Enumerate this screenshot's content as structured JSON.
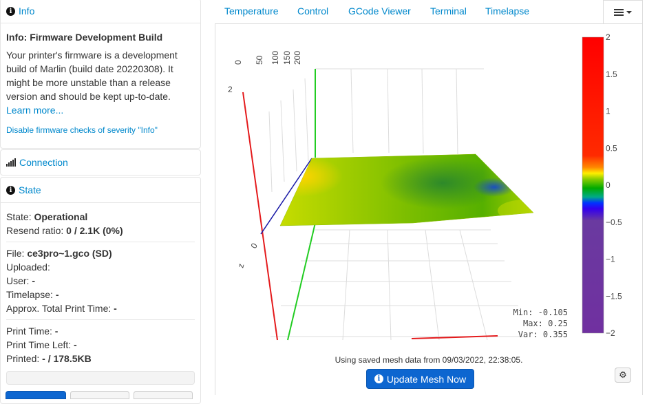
{
  "sidebar": {
    "info": {
      "heading": "Info",
      "title": "Info: Firmware Development Build",
      "message": "Your printer's firmware is a development build of Marlin (build date 20220308). It might be more unstable than a release version and should be kept up-to-date.",
      "learn_more": "Learn more...",
      "disable_link": "Disable firmware checks of severity \"Info\""
    },
    "connection": {
      "heading": "Connection"
    },
    "state": {
      "heading": "State",
      "state_label": "State:",
      "state_value": "Operational",
      "resend_label": "Resend ratio:",
      "resend_value": "0 / 2.1K (0%)",
      "file_label": "File:",
      "file_value": "ce3pro~1.gco (SD)",
      "uploaded_label": "Uploaded:",
      "uploaded_value": "",
      "user_label": "User:",
      "user_value": "-",
      "timelapse_label": "Timelapse:",
      "timelapse_value": "-",
      "approx_label": "Approx. Total Print Time:",
      "approx_value": "-",
      "print_time_label": "Print Time:",
      "print_time_value": "-",
      "print_left_label": "Print Time Left:",
      "print_left_value": "-",
      "printed_label": "Printed:",
      "printed_value": "- / 178.5KB",
      "progress": 0
    }
  },
  "tabs": [
    {
      "label": "Temperature"
    },
    {
      "label": "Control"
    },
    {
      "label": "GCode Viewer"
    },
    {
      "label": "Terminal"
    },
    {
      "label": "Timelapse"
    }
  ],
  "icons": {
    "menu": "hamburger-icon",
    "info": "info-icon",
    "signal": "signal-icon",
    "gear": "gear-icon"
  },
  "colors": {
    "link": "#0088cc",
    "button": "#0d66d0"
  },
  "chart_data": {
    "type": "surface3d",
    "x_ticks": [
      "0",
      "50",
      "100",
      "150",
      "200"
    ],
    "z_ticks": [
      "2",
      "0"
    ],
    "z_label": "z",
    "colorscale_ticks": [
      "2",
      "1.5",
      "1",
      "0.5",
      "0",
      "−0.5",
      "−1",
      "−1.5",
      "−2"
    ],
    "colorscale_range": [
      -2,
      2
    ],
    "stats": {
      "min": "Min: -0.105",
      "max": "Max: 0.25",
      "var": "Var: 0.355"
    }
  },
  "mesh": {
    "note": "Using saved mesh data from 09/03/2022, 22:38:05.",
    "update_label": "Update Mesh Now"
  }
}
